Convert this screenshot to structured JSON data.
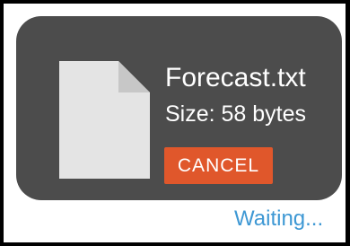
{
  "file": {
    "name": "Forecast.txt",
    "size_label": "Size: 58 bytes",
    "icon": "document-icon"
  },
  "actions": {
    "cancel_label": "CANCEL"
  },
  "status": {
    "text": "Waiting..."
  },
  "colors": {
    "card_background": "#4c4c4c",
    "cancel_button": "#e0572b",
    "status_text": "#3e98d4",
    "file_icon": "#e4e4e4",
    "file_icon_fold": "#c7c7c7"
  }
}
